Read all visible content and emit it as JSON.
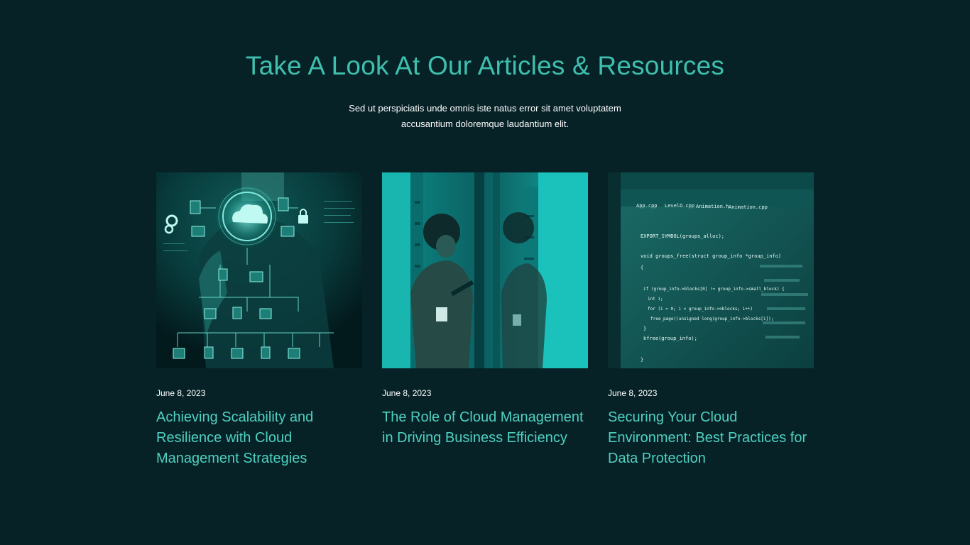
{
  "section": {
    "heading": "Take A Look At Our Articles & Resources",
    "subtitle": "Sed ut perspiciatis unde omnis iste natus error sit amet voluptatem accusantium doloremque laudantium elit."
  },
  "articles": [
    {
      "date": "June 8, 2023",
      "title": "Achieving Scalability and Resilience with Cloud Management Strategies",
      "image": "cloud-network-image"
    },
    {
      "date": "June 8, 2023",
      "title": "The Role of Cloud Management in Driving Business Efficiency",
      "image": "server-room-image"
    },
    {
      "date": "June 8, 2023",
      "title": "Securing Your Cloud Environment: Best Practices for Data Protection",
      "image": "code-screen-image",
      "code_tabs": [
        "App.cpp",
        "LevelD.cpp",
        "Animation.h",
        "Animation.cpp"
      ],
      "code_lines": [
        "EXPORT_SYMBOL(groups_alloc);",
        "void groups_free(struct group_info *group_info)",
        "{",
        "if (group_info->blocks[0] != group_info->small_block) {",
        "int i;",
        "for (i = 0; i < group_info->nblocks; i++)",
        "free_page((unsigned long)group_info->blocks[i]);",
        "}",
        "kfree(group_info);",
        "}"
      ]
    }
  ],
  "colors": {
    "background": "#062227",
    "accent": "#3fbfad",
    "title": "#4fd1c0",
    "text": "#ffffff"
  }
}
